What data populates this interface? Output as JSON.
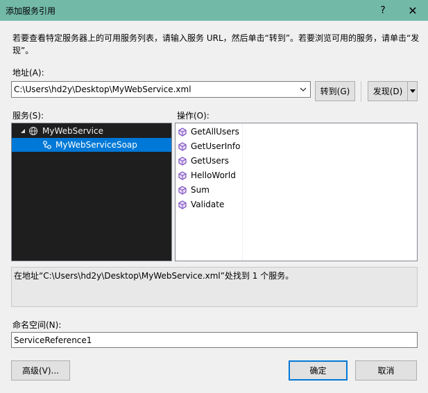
{
  "window": {
    "title": "添加服务引用",
    "help_label": "?",
    "close_label": "✕"
  },
  "instructions": "若要查看特定服务器上的可用服务列表，请输入服务 URL，然后单击“转到”。若要浏览可用的服务，请单击“发现”。",
  "address": {
    "label": "地址(A):",
    "value": "C:\\Users\\hd2y\\Desktop\\MyWebService.xml"
  },
  "buttons": {
    "goto_label": "转到(G)",
    "discover_label": "发现(D)",
    "advanced_label": "高级(V)...",
    "ok_label": "确定",
    "cancel_label": "取消"
  },
  "services": {
    "label": "服务(S):",
    "root": "MyWebService",
    "child": "MyWebServiceSoap"
  },
  "operations": {
    "label": "操作(O):",
    "items": [
      "GetAllUsers",
      "GetUserInfo",
      "GetUsers",
      "HelloWorld",
      "Sum",
      "Validate"
    ]
  },
  "status_message": "在地址“C:\\Users\\hd2y\\Desktop\\MyWebService.xml”处找到 1 个服务。",
  "namespace": {
    "label": "命名空间(N):",
    "value": "ServiceReference1"
  },
  "colors": {
    "titlebar": "#73b9a8",
    "selection": "#0078d7",
    "tree_background": "#1e1e1e",
    "method_icon": "#7b4fc2"
  }
}
